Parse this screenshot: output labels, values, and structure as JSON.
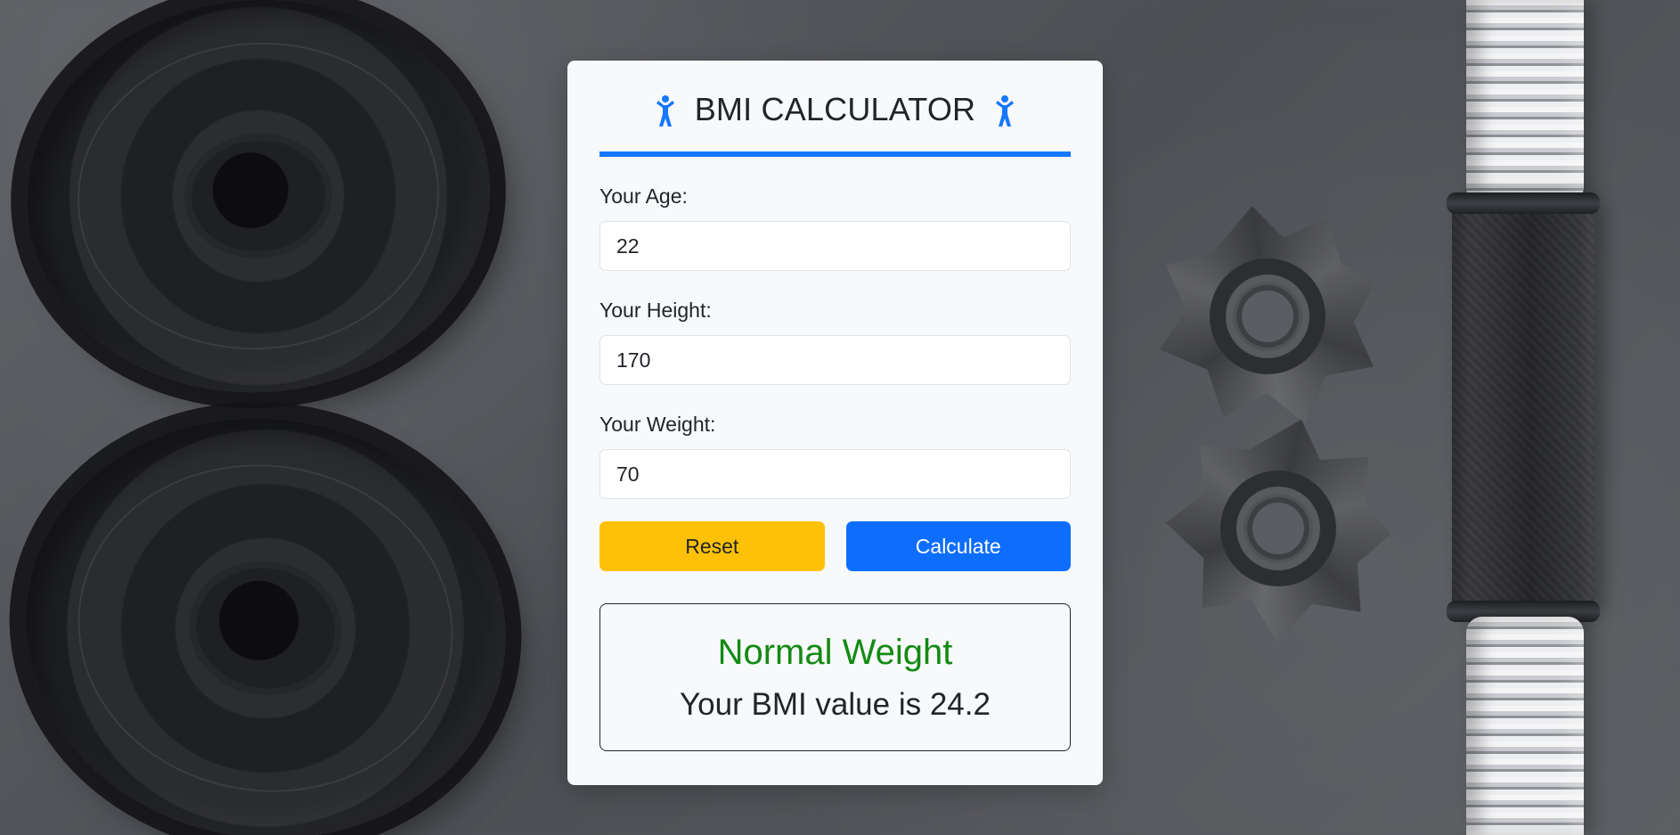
{
  "app": {
    "title": "BMI CALCULATOR",
    "title_icons": [
      "person-icon",
      "person-icon"
    ],
    "accent_color": "#1677ff"
  },
  "form": {
    "age": {
      "label": "Your Age:",
      "value": "22"
    },
    "height": {
      "label": "Your Height:",
      "value": "170"
    },
    "weight": {
      "label": "Your Weight:",
      "value": "70"
    }
  },
  "actions": {
    "reset_label": "Reset",
    "calculate_label": "Calculate",
    "reset_color": "#ffc107",
    "calculate_color": "#0d6efd"
  },
  "result": {
    "status": "Normal Weight",
    "message": "Your BMI value is 24.2",
    "status_color": "#138a13"
  }
}
